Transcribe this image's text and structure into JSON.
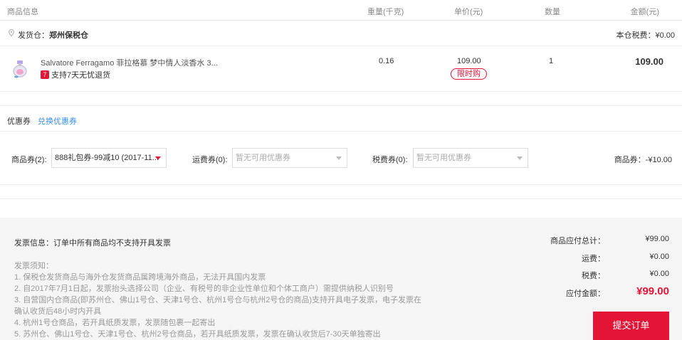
{
  "header": {
    "info": "商品信息",
    "weight": "重量(千克)",
    "price": "单价(元)",
    "qty": "数量",
    "amount": "金额(元)"
  },
  "warehouse": {
    "label": "发货仓：",
    "name": "郑州保税仓",
    "tax": "本仓税费：¥0.00"
  },
  "product": {
    "name": "Salvatore Ferragamo 菲拉格慕 梦中情人淡香水 3...",
    "refund_badge": "7",
    "refund": "支持7天无忧退货",
    "weight": "0.16",
    "price": "109.00",
    "limit_tag": "限时购",
    "qty": "1",
    "amount": "109.00"
  },
  "coupons": {
    "title": "优惠券",
    "exchange": "兑换优惠券",
    "goods_label": "商品券(2):",
    "goods_selected": "888礼包券-99减10 (2017-11...",
    "shipping_label": "运费券(0):",
    "shipping_placeholder": "暂无可用优惠券",
    "tax_label": "税费券(0):",
    "tax_placeholder": "暂无可用优惠券",
    "discount": "商品券：-¥10.00"
  },
  "invoice": {
    "title": "发票信息：订单中所有商品均不支持开具发票",
    "notes_title": "发票须知：",
    "notes": [
      "1. 保税仓发货商品与海外仓发货商品属跨境海外商品，无法开具国内发票",
      "2. 自2017年7月1日起，发票抬头选择公司（企业、有税号的非企业性单位和个体工商户）需提供纳税人识别号",
      "3. 自营国内仓商品(即苏州仓、佛山1号仓、天津1号仓、杭州1号仓与杭州2号仓的商品)支持开具电子发票，电子发票在确认收货后48小时内开具",
      "4. 杭州1号仓商品，若开具纸质发票，发票随包裹一起寄出",
      "5. 苏州仓、佛山1号仓、天津1号仓、杭州2号仓商品，若开具纸质发票，发票在确认收货后7-30天单独寄出"
    ]
  },
  "summary": {
    "goods_label": "商品应付总计：",
    "goods_value": "¥99.00",
    "shipping_label": "运费：",
    "shipping_value": "¥0.00",
    "tax_label": "税费：",
    "tax_value": "¥0.00",
    "total_label": "应付金额：",
    "total_value": "¥99.00",
    "submit": "提交订单"
  },
  "colors": {
    "accent": "#e31436",
    "link": "#3a8ee6",
    "footer_bg": "#f5f5f5"
  }
}
